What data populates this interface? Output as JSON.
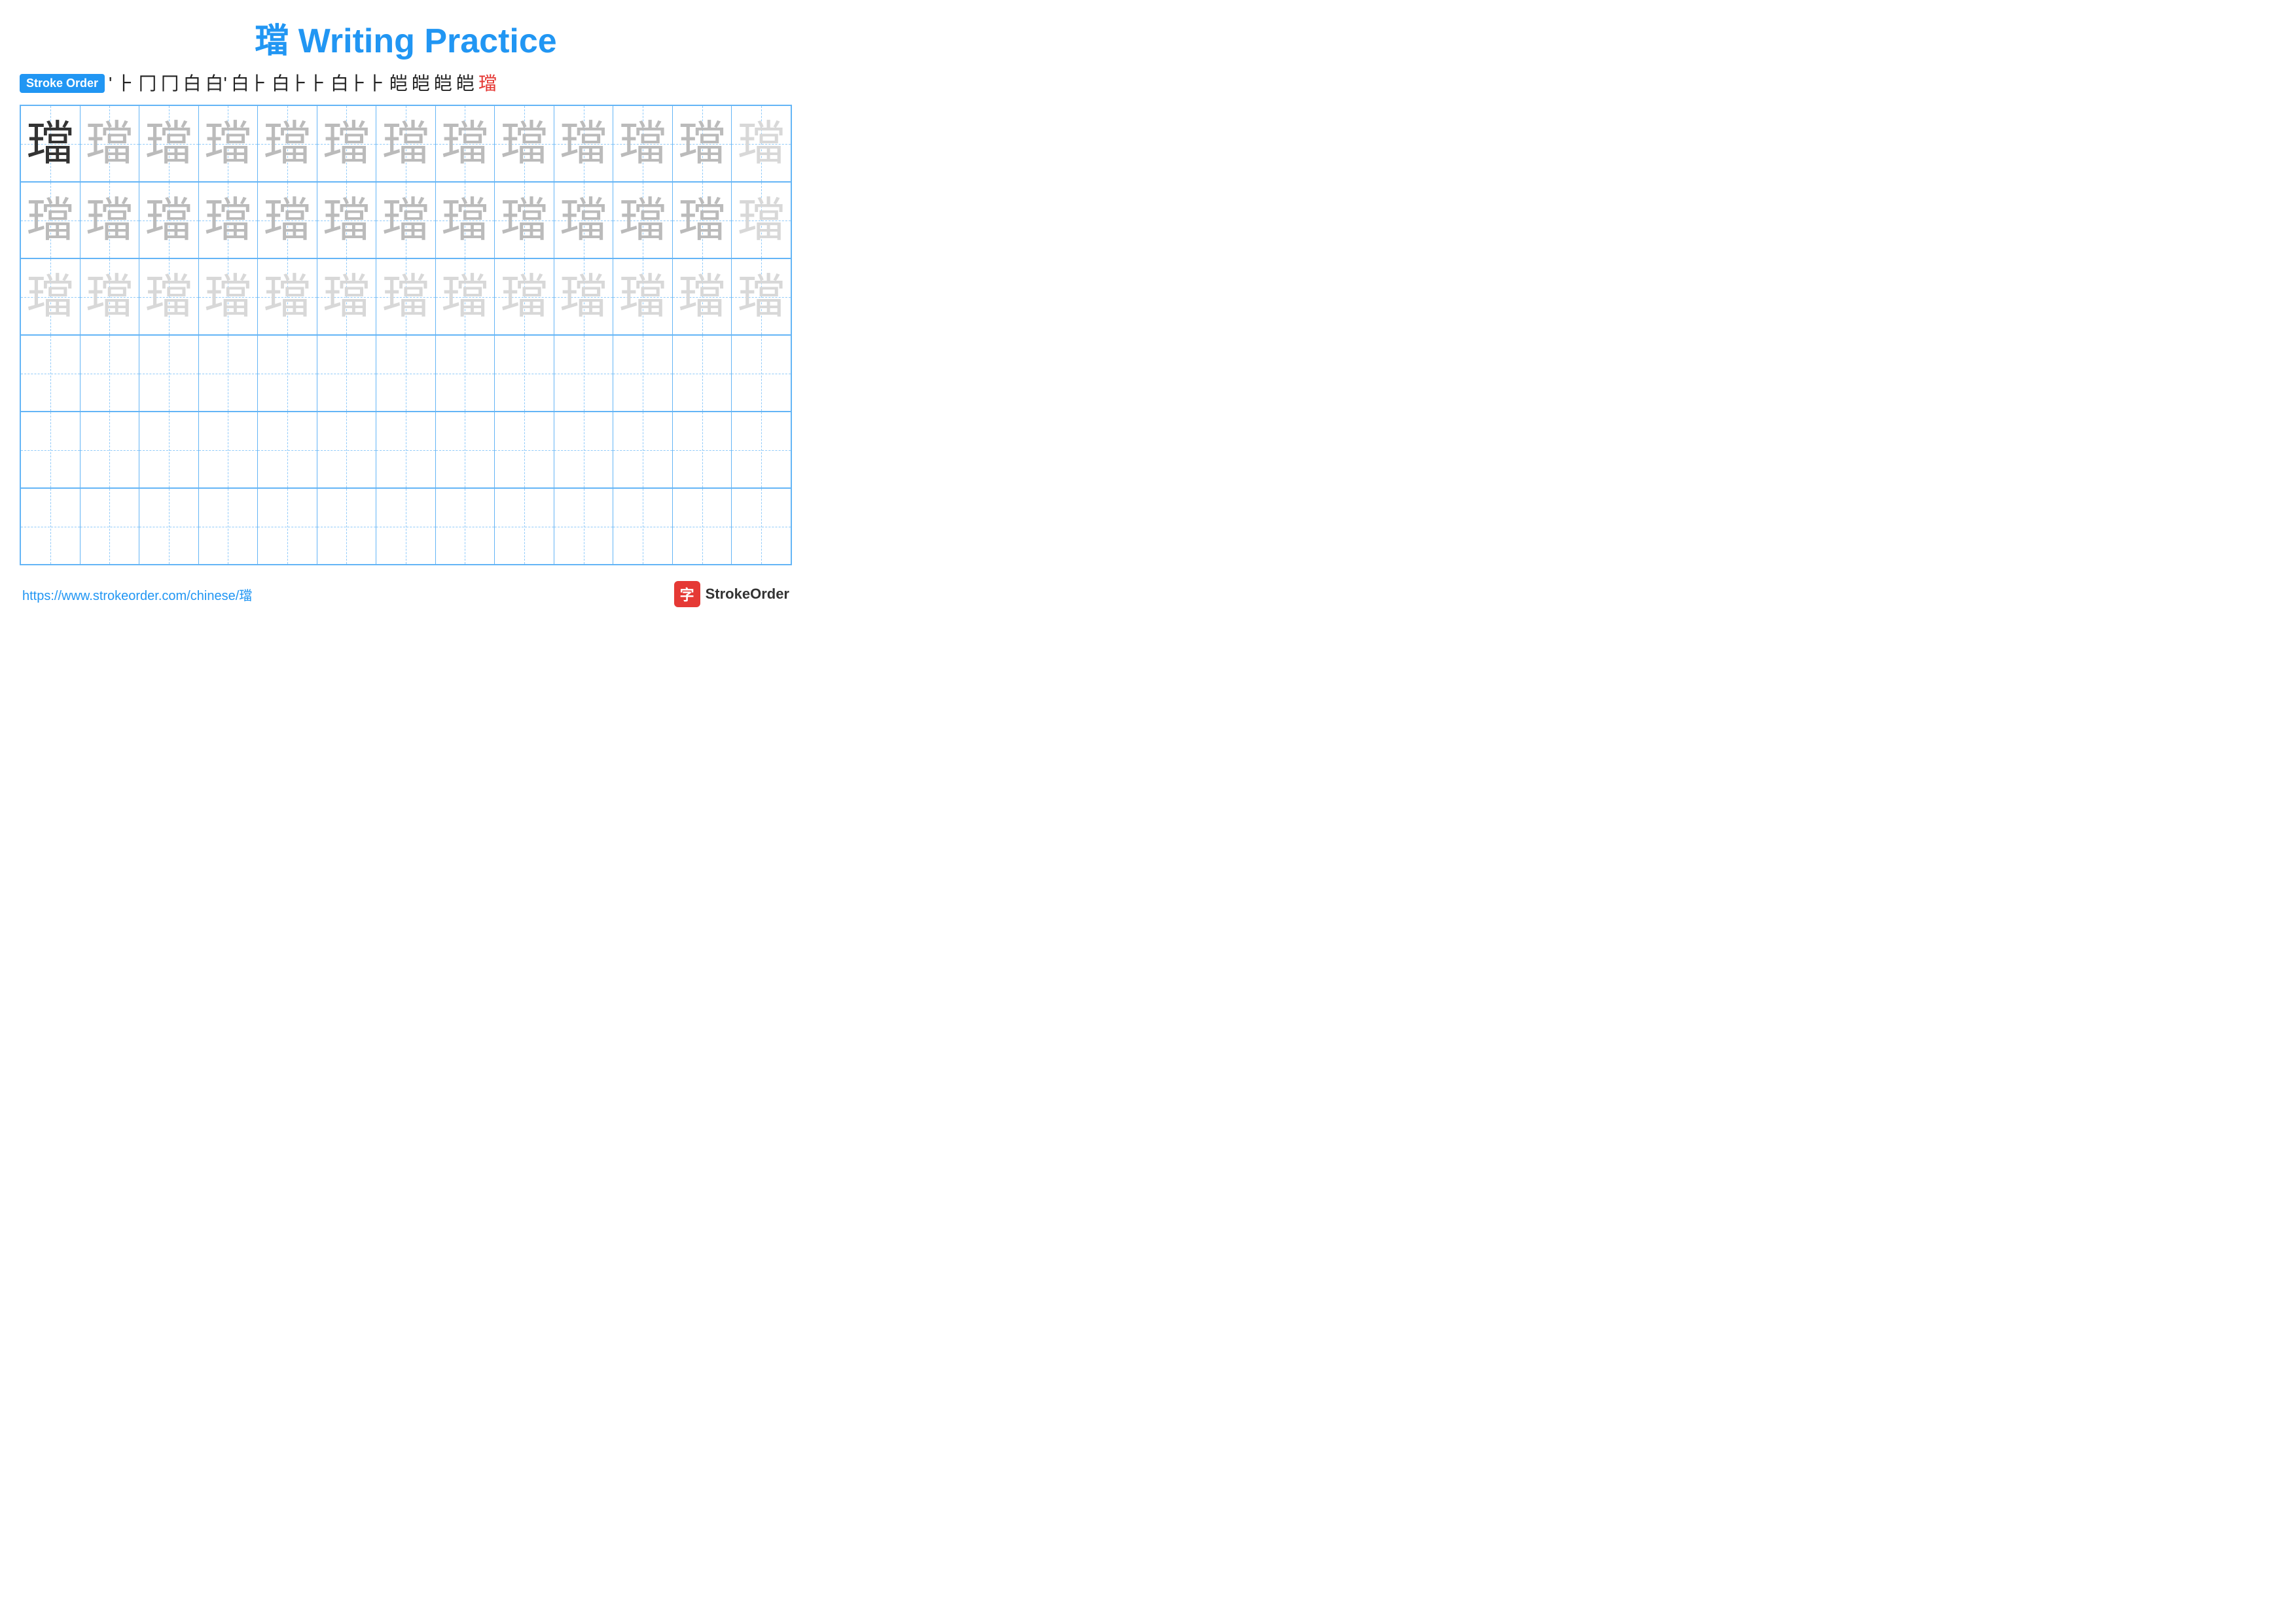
{
  "title": {
    "char": "璫",
    "label": "璫 Writing Practice"
  },
  "stroke_order": {
    "badge_label": "Stroke Order",
    "strokes": [
      "'",
      "⺊",
      "冂",
      "冂",
      "白",
      "白'",
      "白⺊",
      "白⺊⺊",
      "白⺊⺊",
      "璫0",
      "璫1",
      "璫2",
      "璫3",
      "璫4",
      "璫"
    ]
  },
  "grid": {
    "char": "璫",
    "rows": [
      {
        "type": "dark_fade",
        "cells": [
          "dark",
          "medium",
          "medium",
          "medium",
          "medium",
          "medium",
          "medium",
          "medium",
          "medium",
          "medium",
          "medium",
          "medium",
          "light"
        ]
      },
      {
        "type": "medium_fade",
        "cells": [
          "medium",
          "medium",
          "medium",
          "medium",
          "medium",
          "medium",
          "medium",
          "medium",
          "medium",
          "medium",
          "medium",
          "medium",
          "light"
        ]
      },
      {
        "type": "light_fade",
        "cells": [
          "light",
          "light",
          "light",
          "light",
          "light",
          "light",
          "light",
          "light",
          "light",
          "light",
          "light",
          "light",
          "light"
        ]
      },
      {
        "type": "empty",
        "cells": [
          "empty",
          "empty",
          "empty",
          "empty",
          "empty",
          "empty",
          "empty",
          "empty",
          "empty",
          "empty",
          "empty",
          "empty",
          "empty"
        ]
      },
      {
        "type": "empty",
        "cells": [
          "empty",
          "empty",
          "empty",
          "empty",
          "empty",
          "empty",
          "empty",
          "empty",
          "empty",
          "empty",
          "empty",
          "empty",
          "empty"
        ]
      },
      {
        "type": "empty",
        "cells": [
          "empty",
          "empty",
          "empty",
          "empty",
          "empty",
          "empty",
          "empty",
          "empty",
          "empty",
          "empty",
          "empty",
          "empty",
          "empty"
        ]
      }
    ]
  },
  "footer": {
    "url": "https://www.strokeorder.com/chinese/璫",
    "brand_name": "StrokeOrder",
    "brand_icon": "字"
  }
}
